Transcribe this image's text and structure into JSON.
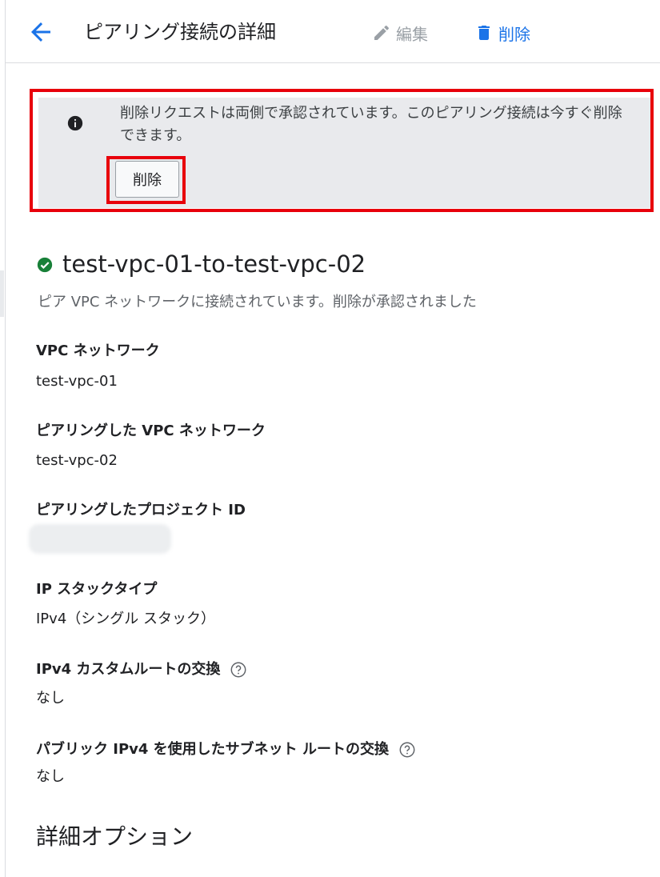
{
  "header": {
    "title": "ピアリング接続の詳細",
    "edit_label": "編集",
    "delete_label": "削除"
  },
  "banner": {
    "message": "削除リクエストは両側で承認されています。このピアリング接続は今すぐ削除できます。",
    "button_label": "削除"
  },
  "connection": {
    "name": "test-vpc-01-to-test-vpc-02",
    "status": "ピア VPC ネットワークに接続されています。削除が承認されました"
  },
  "fields": [
    {
      "label": "VPC ネットワーク",
      "value": "test-vpc-01"
    },
    {
      "label": "ピアリングした VPC ネットワーク",
      "value": "test-vpc-02"
    },
    {
      "label": "ピアリングしたプロジェクト ID",
      "value": ""
    },
    {
      "label": "IP スタックタイプ",
      "value": "IPv4（シングル スタック）"
    },
    {
      "label": "IPv4 カスタムルートの交換",
      "value": "なし"
    },
    {
      "label": "パブリック IPv4 を使用したサブネット ルートの交換",
      "value": "なし"
    }
  ],
  "section_title": "詳細オプション",
  "colors": {
    "accent": "#1a73e8",
    "success": "#188038",
    "highlight": "#e8000b",
    "banner_bg": "#e9eaed",
    "disabled": "#9aa0a6"
  },
  "icons": [
    "arrow-back-icon",
    "edit-pencil-icon",
    "trash-icon",
    "info-icon",
    "check-circle-icon",
    "help-icon"
  ]
}
